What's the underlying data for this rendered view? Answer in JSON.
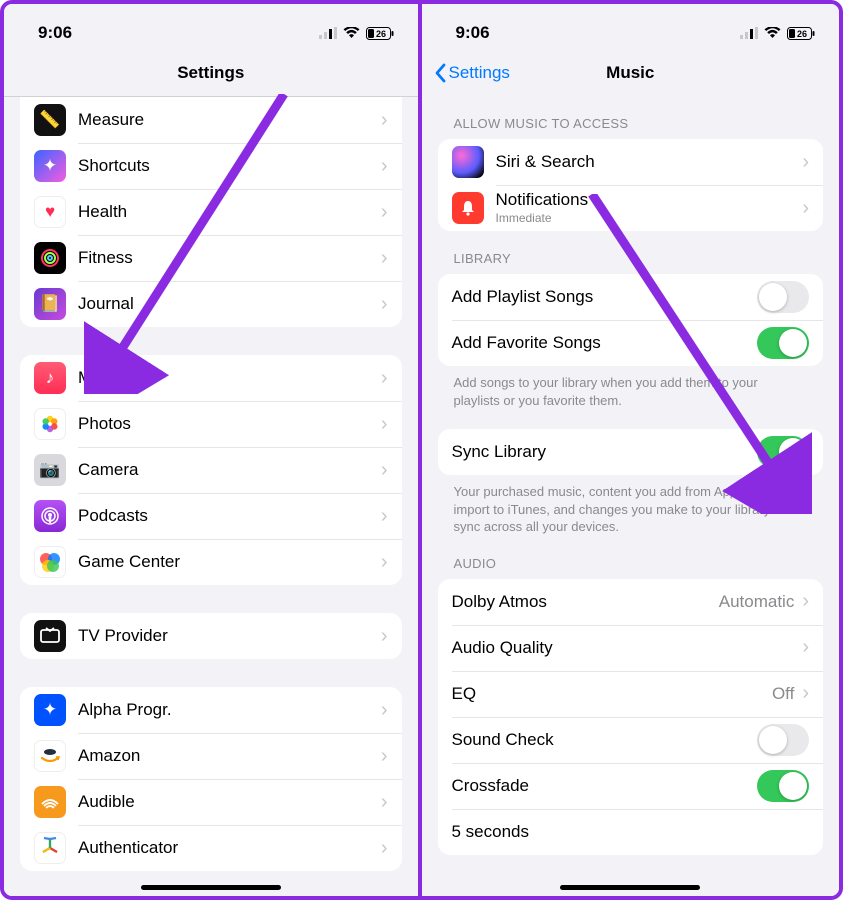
{
  "status": {
    "time": "9:06",
    "battery": "26"
  },
  "left": {
    "title": "Settings",
    "groups": {
      "g1": [
        {
          "name": "measure",
          "label": "Measure"
        },
        {
          "name": "shortcuts",
          "label": "Shortcuts"
        },
        {
          "name": "health",
          "label": "Health"
        },
        {
          "name": "fitness",
          "label": "Fitness"
        },
        {
          "name": "journal",
          "label": "Journal"
        }
      ],
      "g2": [
        {
          "name": "music",
          "label": "Music"
        },
        {
          "name": "photos",
          "label": "Photos"
        },
        {
          "name": "camera",
          "label": "Camera"
        },
        {
          "name": "podcasts",
          "label": "Podcasts"
        },
        {
          "name": "gamecenter",
          "label": "Game Center"
        }
      ],
      "g3": [
        {
          "name": "tvprovider",
          "label": "TV Provider"
        }
      ],
      "g4": [
        {
          "name": "alpha",
          "label": "Alpha Progr."
        },
        {
          "name": "amazon",
          "label": "Amazon"
        },
        {
          "name": "audible",
          "label": "Audible"
        },
        {
          "name": "authenticator",
          "label": "Authenticator"
        }
      ]
    }
  },
  "right": {
    "back": "Settings",
    "title": "Music",
    "section_access": "ALLOW MUSIC TO ACCESS",
    "access": {
      "siri": "Siri & Search",
      "notif_label": "Notifications",
      "notif_sub": "Immediate"
    },
    "section_library": "LIBRARY",
    "library": {
      "add_playlist": "Add Playlist Songs",
      "add_favorite": "Add Favorite Songs",
      "lib_footer": "Add songs to your library when you add them to your playlists or you favorite them."
    },
    "sync": {
      "label": "Sync Library",
      "footer": "Your purchased music, content you add from Apple Music or import to iTunes, and changes you make to your library will sync across all your devices."
    },
    "section_audio": "AUDIO",
    "audio": {
      "dolby": "Dolby Atmos",
      "dolby_val": "Automatic",
      "aq": "Audio Quality",
      "eq": "EQ",
      "eq_val": "Off",
      "soundcheck": "Sound Check",
      "crossfade": "Crossfade",
      "crossfade_val": "5 seconds"
    }
  }
}
